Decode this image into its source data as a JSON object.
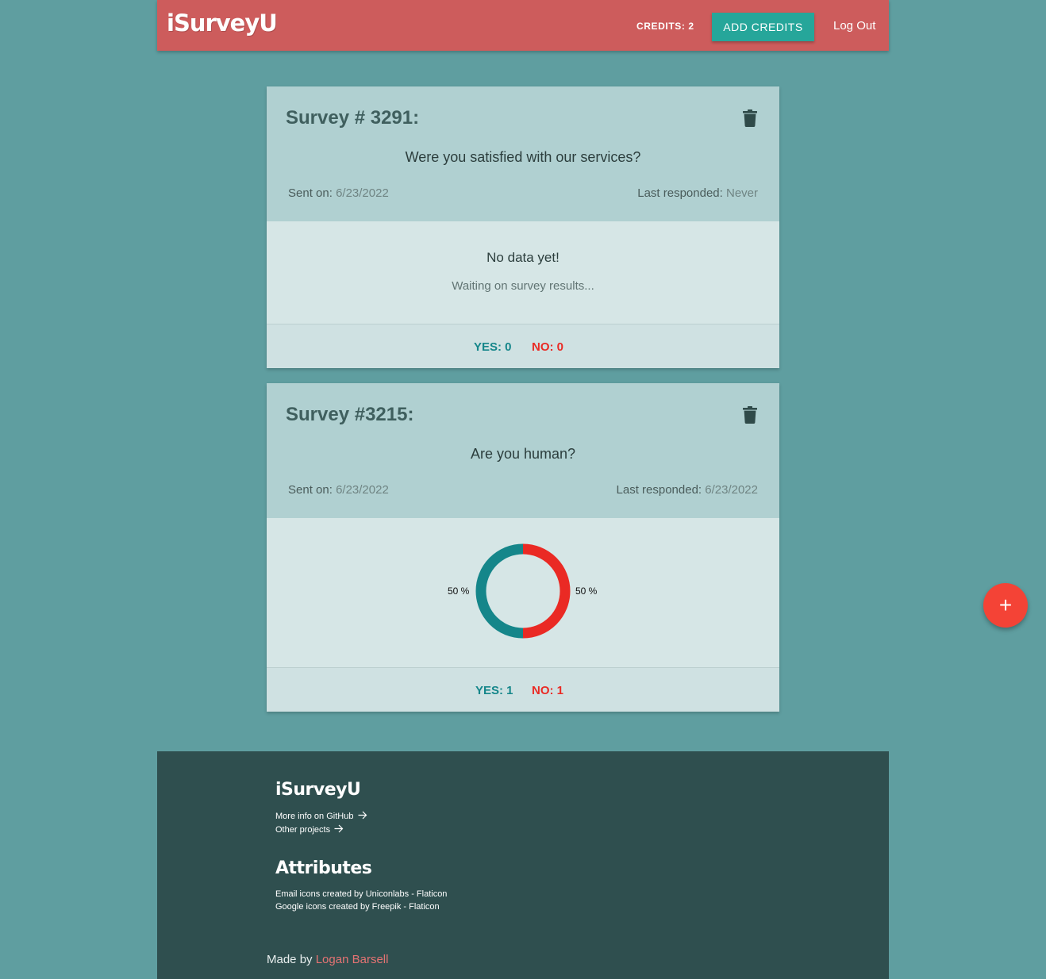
{
  "navbar": {
    "brand": "iSurveyU",
    "credits": "CREDITS: 2",
    "add_credits_label": "ADD CREDITS",
    "logout_label": "Log Out",
    "color": "#cd5c5c"
  },
  "surveys": [
    {
      "title": "Survey # 3291:",
      "question": "Were you satisfied with our services?",
      "sent_label": "Sent on:",
      "sent_date": "6/23/2022",
      "last_label": "Last responded:",
      "last_value": "Never",
      "no_data_title": "No data yet!",
      "no_data_sub": "Waiting on survey results...",
      "yes_label": "YES: 0",
      "no_label": "NO: 0"
    },
    {
      "title": "Survey #3215:",
      "question": "Are you human?",
      "sent_label": "Sent on:",
      "sent_date": "6/23/2022",
      "last_label": "Last responded:",
      "last_value": "6/23/2022",
      "yes_label": "YES: 1",
      "no_label": "NO: 1",
      "chart_left_label": "50 %",
      "chart_right_label": "50 %"
    }
  ],
  "chart_data": {
    "type": "pie",
    "categories": [
      "Yes",
      "No"
    ],
    "values": [
      1,
      1
    ],
    "colors": [
      "#15868a",
      "#ea2a24"
    ]
  },
  "fab": {
    "icon": "plus-icon",
    "label": "+"
  },
  "footer": {
    "brand": "iSurveyU",
    "links": [
      "More info on GitHub",
      "Other projects"
    ],
    "attributes_title": "Attributes",
    "attributes": [
      "Email icons created by Uniconlabs - Flaticon",
      "Google icons created by Freepik - Flaticon"
    ],
    "made_by_label": "Made by",
    "author": "Logan Barsell"
  },
  "colors": {
    "background": "#5f9ea0",
    "accent": "#26a69a",
    "yes": "#15868a",
    "no": "#ea2a24",
    "footer": "#2f4f4f"
  }
}
